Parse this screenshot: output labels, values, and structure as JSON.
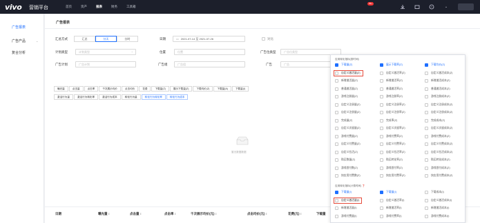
{
  "topbar": {
    "logo": "vivo",
    "brand": "营销平台",
    "nav": [
      "首页",
      "资产",
      "报表",
      "财务",
      "工具箱"
    ],
    "active_nav": 2,
    "badge": "99+"
  },
  "sidebar": {
    "items": [
      {
        "label": "广告报表",
        "active": true
      },
      {
        "label": "广告产品",
        "active": false,
        "has_arrow": true
      },
      {
        "label": "复合分析",
        "active": false
      }
    ]
  },
  "main": {
    "title": "广告报表",
    "filters": {
      "summary_label": "汇总方式",
      "summary_options": [
        "汇总",
        "分天",
        "分时"
      ],
      "summary_active": 1,
      "date_label": "日期",
      "date_range": "2021-07-14 至 2021-07-26",
      "compare_label": "对比",
      "plan_type_label": "计划类型",
      "plan_type_placeholder": "计划类型",
      "position_label": "位置",
      "position_placeholder": "位置",
      "ad_position_type_label": "广告位类型",
      "ad_position_type_placeholder": "广告位类型",
      "ad_plan_label": "广告计划",
      "ad_plan_placeholder": "广告计划",
      "ad_group_label": "广告组",
      "ad_group_placeholder": "广告组",
      "ad_label": "广告",
      "ad_placeholder": "广告"
    },
    "tags_row1": [
      "曝光量",
      "点击量",
      "点击率",
      "千次展示均价",
      "点击均价",
      "花费",
      "下载量(Z)",
      "展示下载量(Z)",
      "下载均价(Z)",
      "下载量(A)",
      "下载量(I)"
    ],
    "tags_row2": [
      "激活行为量",
      "激活行为转化率",
      "激活行为成本",
      "转化行为量",
      "转化行为转化率",
      "转化行为成本"
    ],
    "tags_row2_blue": [
      4,
      5
    ],
    "empty_text": "暂无数据数据",
    "table_headers": [
      "日期",
      "曝光量 ↕",
      "点击量 ↕",
      "点击率 ↕",
      "千次展示均价(元) ↕",
      "点击均价(元) ↕",
      "花费(元) ↕",
      "下载量"
    ]
  },
  "popup": {
    "section1_title": "应用转化指标(按时间)",
    "section2_title": "应用转化指标(计费时间) ❓",
    "col1": [
      {
        "label": "下载量(Z)",
        "checked": true
      },
      {
        "label": "自定义激活量(Z)",
        "checked": false,
        "highlight": true
      },
      {
        "label": "新增激活量(Z)",
        "checked": false
      },
      {
        "label": "普通激活量(Z)",
        "checked": false
      },
      {
        "label": "游戏注册量(Z)",
        "checked": false
      },
      {
        "label": "自定义注册量(Z)",
        "checked": false
      },
      {
        "label": "自定义注册量(Z)",
        "checked": false
      },
      {
        "label": "完成量(Z)",
        "checked": false
      },
      {
        "label": "自定义次留量(Z)",
        "checked": false
      },
      {
        "label": "游戏付费量(Z)",
        "checked": false
      },
      {
        "label": "自定义付费量(Z)",
        "checked": false
      },
      {
        "label": "自定义拉活(Z)",
        "checked": false
      },
      {
        "label": "购买数量(Z)",
        "checked": false
      },
      {
        "label": "游戏首付数(Z)",
        "checked": false
      },
      {
        "label": "快应用付费数(Z)",
        "checked": false
      }
    ],
    "col2": [
      {
        "label": "展示下载率(Z)",
        "checked": true
      },
      {
        "label": "自定义激活率(Z)",
        "checked": false
      },
      {
        "label": "新增激活率(Z)",
        "checked": false
      },
      {
        "label": "普通激活率(Z)",
        "checked": false
      },
      {
        "label": "游戏注册率(Z)",
        "checked": false
      },
      {
        "label": "自定义注册率(Z)",
        "checked": false
      },
      {
        "label": "自定义注册率(Z)",
        "checked": false
      },
      {
        "label": "完成率(Z)",
        "checked": false
      },
      {
        "label": "自定义次留率(Z)",
        "checked": false
      },
      {
        "label": "游戏付费率(Z)",
        "checked": false
      },
      {
        "label": "自定义付费率(Z)",
        "checked": false
      },
      {
        "label": "自定义拉活率(Z)",
        "checked": false
      },
      {
        "label": "购买转化率(Z)",
        "checked": false
      },
      {
        "label": "游戏首付率(Z)",
        "checked": false
      },
      {
        "label": "快应用付费率(Z)",
        "checked": false
      }
    ],
    "col3": [
      {
        "label": "下载均价(Z)",
        "checked": true
      },
      {
        "label": "自定义激活成本(Z)",
        "checked": false
      },
      {
        "label": "新增激活成本(Z)",
        "checked": false
      },
      {
        "label": "普通激活成本(Z)",
        "checked": false
      },
      {
        "label": "游戏注册成本(Z)",
        "checked": false
      },
      {
        "label": "自定义注册成本(Z)",
        "checked": false
      },
      {
        "label": "自定义注册成本(Z)",
        "checked": false
      },
      {
        "label": "完成成本(Z)",
        "checked": false
      },
      {
        "label": "自定义次留成本(Z)",
        "checked": false
      },
      {
        "label": "游戏付费成本(Z)",
        "checked": false
      },
      {
        "label": "自定义付费成本(Z)",
        "checked": false
      },
      {
        "label": "自定义拉活成本(Z)",
        "checked": false
      },
      {
        "label": "购买转化成本(Z)",
        "checked": false
      },
      {
        "label": "游戏首付成本(Z)",
        "checked": false
      },
      {
        "label": "快应用付费成本(Z)",
        "checked": false
      }
    ],
    "section2_col1": [
      {
        "label": "下载量(I)",
        "checked": true
      },
      {
        "label": "自定义激活量(I)",
        "checked": false,
        "highlight": true
      },
      {
        "label": "新增激活量(I)",
        "checked": false
      },
      {
        "label": "游戏付费量(I)",
        "checked": false
      }
    ],
    "section2_col2": [
      {
        "label": "下载量(I)",
        "checked": true
      },
      {
        "label": "自定义激活率(I)",
        "checked": false
      },
      {
        "label": "新增激活率(I)",
        "checked": false
      },
      {
        "label": "游戏付费率(I)",
        "checked": false
      }
    ],
    "section2_col3": [
      {
        "label": "下载成本(I)",
        "checked": false
      },
      {
        "label": "自定义激活成本(I)",
        "checked": false
      },
      {
        "label": "新增激活成本(I)",
        "checked": false
      },
      {
        "label": "游戏付费成本(I)",
        "checked": false
      }
    ]
  },
  "colors": {
    "accent": "#1e6fff",
    "topbar": "#1c1f2b",
    "highlight_box": "#e64a3a"
  }
}
